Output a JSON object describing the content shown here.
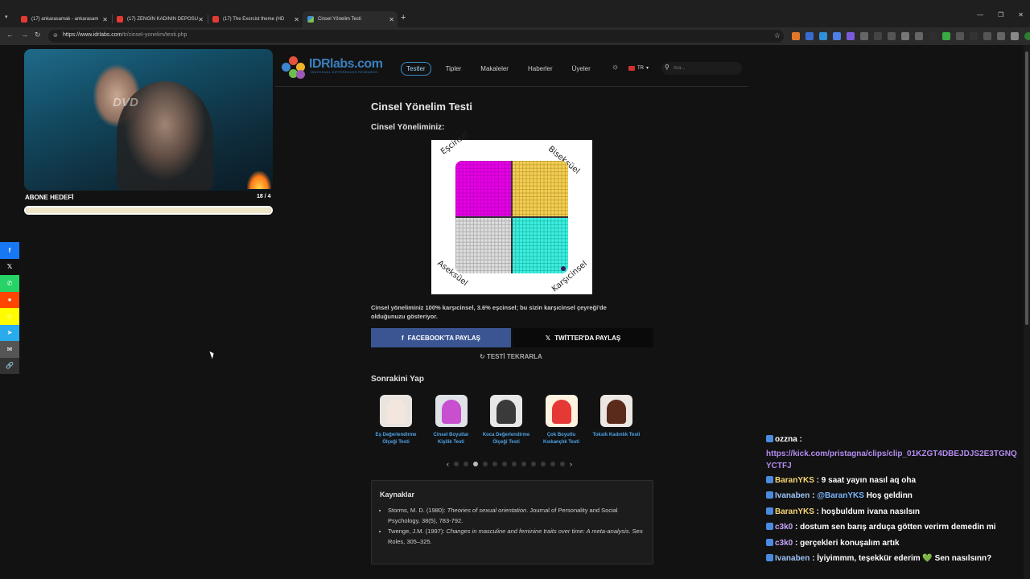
{
  "browser": {
    "tabs": [
      {
        "title": "(17) ankarasamak - ankarasam",
        "icon": "youtube-icon"
      },
      {
        "title": "(17) ZENGİN KADININ DEPOSU",
        "icon": "youtube-icon"
      },
      {
        "title": "(17) The Exorcist theme (HD",
        "icon": "youtube-icon"
      },
      {
        "title": "Cinsel Yönelim Testi",
        "icon": "idrlabs-icon"
      }
    ],
    "url_host": "https://www.idrlabs.com",
    "url_path": "/tr/cinsel-yonelim/testi.php"
  },
  "stream": {
    "sub_goal_label": "ABONE HEDEFİ",
    "sub_goal_count": "18 / 4",
    "sub_goal_progress": 1.0,
    "dvd_text": "DVD"
  },
  "share": [
    {
      "icon": "facebook-icon",
      "glyph": "f",
      "color": "#1877f2"
    },
    {
      "icon": "x-icon",
      "glyph": "𝕏",
      "color": "#111111"
    },
    {
      "icon": "whatsapp-icon",
      "glyph": "✆",
      "color": "#25d366"
    },
    {
      "icon": "reddit-icon",
      "glyph": "●",
      "color": "#ff4500"
    },
    {
      "icon": "snapchat-icon",
      "glyph": "☺",
      "color": "#fffc00"
    },
    {
      "icon": "telegram-icon",
      "glyph": "➤",
      "color": "#2aabee"
    },
    {
      "icon": "email-icon",
      "glyph": "✉",
      "color": "#555555"
    },
    {
      "icon": "link-icon",
      "glyph": "🔗",
      "color": "#333333"
    }
  ],
  "site": {
    "brand": "IDRlabs.com",
    "brand_sub": "INDIVIDUAL DIFFERENCES RESEARCH",
    "nav": [
      "Testler",
      "Tipler",
      "Makaleler",
      "Haberler",
      "Üyeler"
    ],
    "lang": "TR",
    "search_placeholder": "Ara..."
  },
  "test": {
    "title": "Cinsel Yönelim Testi",
    "subtitle": "Cinsel Yöneliminiz:",
    "labels": {
      "tl": "Eşcinsel",
      "tr": "Biseksüel",
      "bl": "Aseksüel",
      "br": "Karşıcinsel"
    },
    "result": "Cinsel yöneliminiz 100% karşıcinsel, 3.6% eşcinsel; bu sizin karşıcinsel çeyreği'de olduğunuzu gösteriyor.",
    "share_facebook": "FACEBOOK'TA PAYLAŞ",
    "share_twitter": "TWİTTER'DA PAYLAŞ",
    "retake": "TESTİ TEKRARLA",
    "next_title": "Sonrakini Yap",
    "next_tests": [
      {
        "name": "Eş Değerlendirme Ölçeği Testi",
        "icon": "bride-icon"
      },
      {
        "name": "Cinsel Boyutlar Kişilik Testi",
        "icon": "question-mark-icon"
      },
      {
        "name": "Koca Değerlendirme Ölçeği Testi",
        "icon": "groom-icon"
      },
      {
        "name": "Çok Boyutlu Kıskançlık Testi",
        "icon": "flaming-heart-icon"
      },
      {
        "name": "Toksik Kadınlık Testi",
        "icon": "woman-icon"
      }
    ],
    "refs_title": "Kaynaklar",
    "refs": [
      {
        "pre": "Storms, M. D. (1980): ",
        "em": "Theories of sexual orientation",
        "post": ". Journal of Personality and Social Psychology, 38(5), 783-792."
      },
      {
        "pre": "Twenge, J.M. (1997): ",
        "em": "Changes in masculine and feminine traits over time: A meta-analysis",
        "post": ". Sex Roles, 305–325."
      }
    ]
  },
  "chart_data": {
    "type": "scatter",
    "x": [
      100
    ],
    "y": [
      3.6
    ],
    "xlabel": "",
    "ylabel": "",
    "quadrants": [
      "Eşcinsel",
      "Biseksüel",
      "Aseksüel",
      "Karşıcinsel"
    ]
  },
  "chat": [
    {
      "user": "ozzna",
      "color": "#ffffff",
      "text": "",
      "link": "https://kick.com/pristagna/clips/clip_01KZGT4DBEJDJS2E3TGNQYCTFJ"
    },
    {
      "user": "BaranYKS",
      "color": "#f7d774",
      "text": "9 saat yayın nasıl aq oha"
    },
    {
      "user": "Ivanaben",
      "color": "#9ec5f5",
      "mention": "@BaranYKS",
      "text": "Hoş geldinn"
    },
    {
      "user": "BaranYKS",
      "color": "#f7d774",
      "text": "hoşbuldum ivana nasılsın"
    },
    {
      "user": "c3k0",
      "color": "#c9a6ff",
      "text": "dostum sen barış arduça götten verirm demedin mi"
    },
    {
      "user": "c3k0",
      "color": "#c9a6ff",
      "text": "gerçekleri konuşalım artık"
    },
    {
      "user": "Ivanaben",
      "color": "#9ec5f5",
      "text": "İyiyimmm, teşekkür ederim 💚 Sen nasılsınn?"
    }
  ]
}
